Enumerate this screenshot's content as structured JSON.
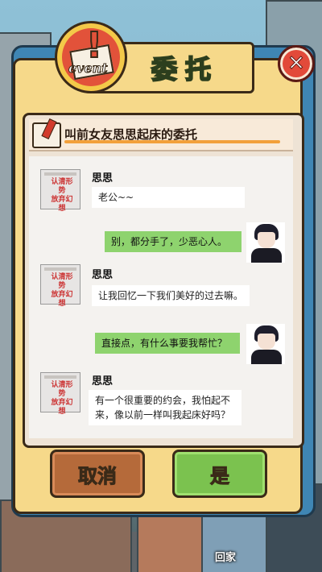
{
  "dialog": {
    "badge_word": "event",
    "title": "委托",
    "close_symbol": "✕",
    "request_title": "叫前女友思思起床的委托"
  },
  "npc": {
    "name": "思思",
    "avatar_tag": "认清形势\n放弃幻想"
  },
  "messages": [
    {
      "from": "npc",
      "text": "老公~~"
    },
    {
      "from": "player",
      "text": "别，都分手了，少恶心人。"
    },
    {
      "from": "npc",
      "text": "让我回忆一下我们美好的过去嘛。"
    },
    {
      "from": "player",
      "text": "直接点，有什么事要我帮忙？"
    },
    {
      "from": "npc",
      "text": "有一个很重要的约会，我怕起不来，像以前一样叫我起床好吗？"
    }
  ],
  "buttons": {
    "cancel": "取消",
    "yes": "是"
  },
  "home": {
    "label": "回家"
  }
}
